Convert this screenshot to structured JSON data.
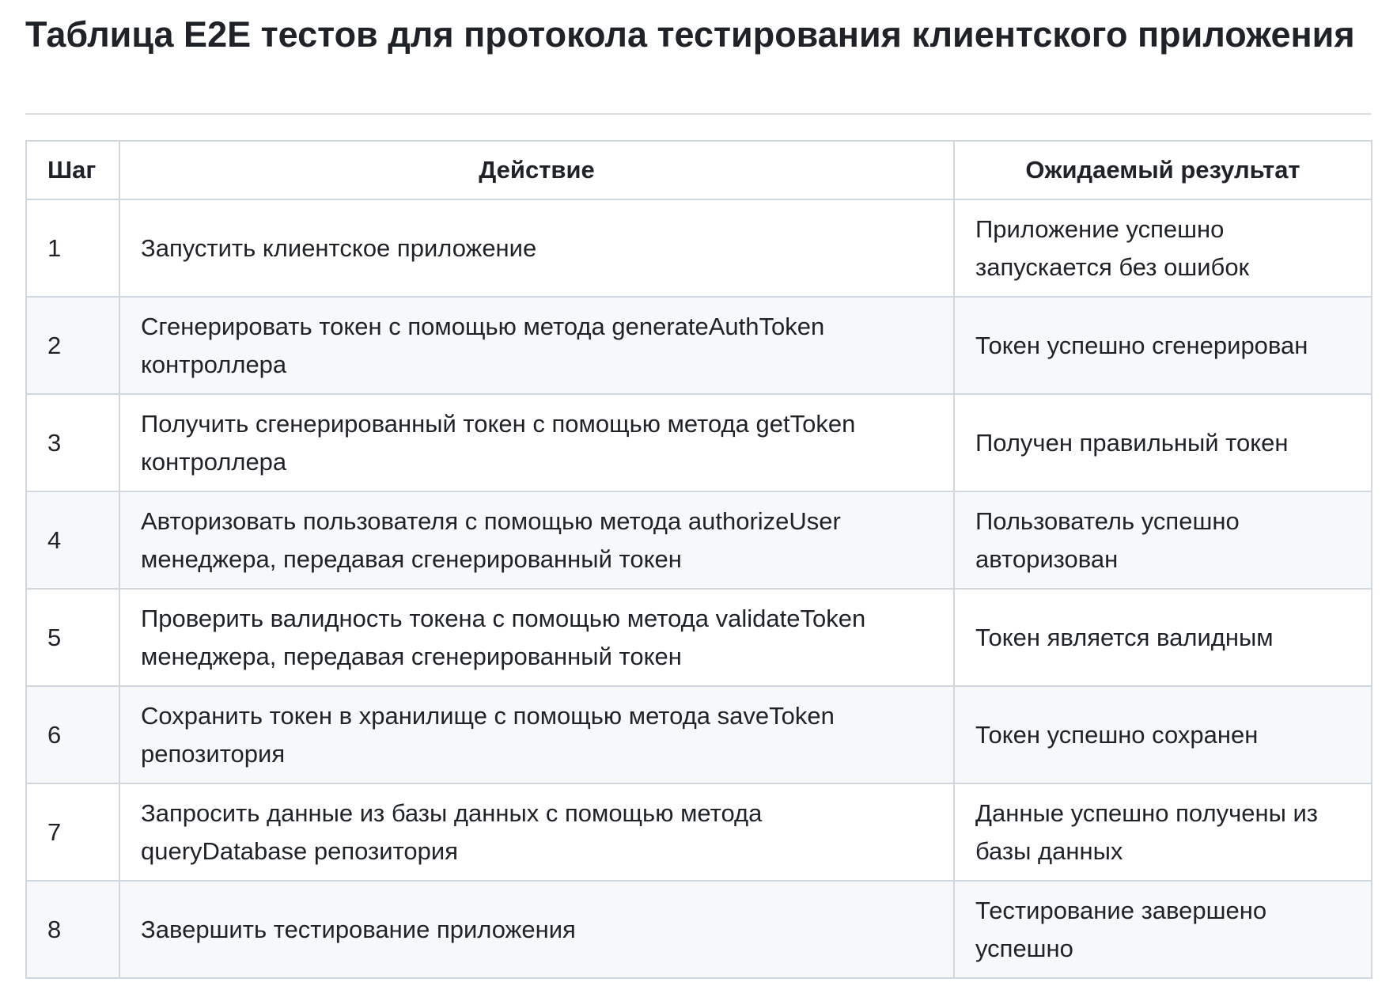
{
  "title": "Таблица E2E тестов для протокола тестирования клиентского приложения",
  "table": {
    "headers": [
      "Шаг",
      "Действие",
      "Ожидаемый результат"
    ],
    "rows": [
      {
        "step": "1",
        "action": "Запустить клиентское приложение",
        "result": "Приложение успешно запускается без ошибок"
      },
      {
        "step": "2",
        "action": "Сгенерировать токен с помощью метода generateAuthToken контроллера",
        "result": "Токен успешно сгенерирован"
      },
      {
        "step": "3",
        "action": "Получить сгенерированный токен с помощью метода getToken контроллера",
        "result": "Получен правильный токен"
      },
      {
        "step": "4",
        "action": "Авторизовать пользователя с помощью метода authorizeUser менеджера, передавая сгенерированный токен",
        "result": "Пользователь успешно авторизован"
      },
      {
        "step": "5",
        "action": "Проверить валидность токена с помощью метода validateToken менеджера, передавая сгенерированный токен",
        "result": "Токен является валидным"
      },
      {
        "step": "6",
        "action": "Сохранить токен в хранилище с помощью метода saveToken репозитория",
        "result": "Токен успешно сохранен"
      },
      {
        "step": "7",
        "action": "Запросить данные из базы данных с помощью метода queryDatabase репозитория",
        "result": "Данные успешно получены из базы данных"
      },
      {
        "step": "8",
        "action": "Завершить тестирование приложения",
        "result": "Тестирование завершено успешно"
      }
    ]
  }
}
